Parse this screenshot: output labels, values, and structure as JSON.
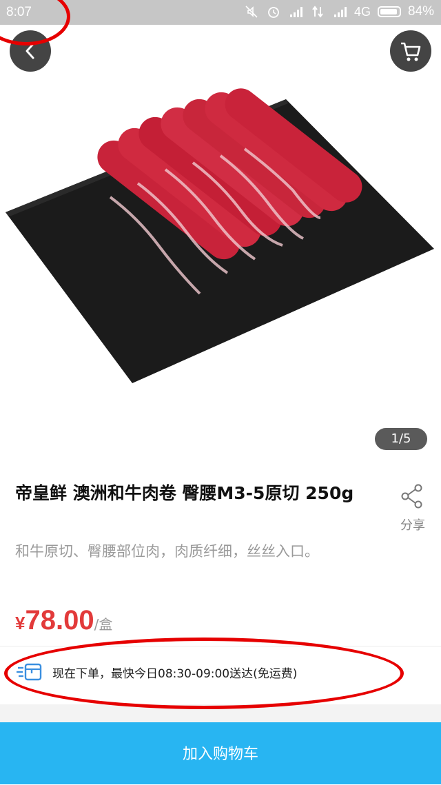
{
  "status_bar": {
    "time": "8:07",
    "network": "4G",
    "battery": "84%"
  },
  "product": {
    "image_indicator": "1/5",
    "title": "帝皇鲜 澳洲和牛肉卷 臀腰M3-5原切 250g",
    "description": "和牛原切、臀腰部位肉，肉质纤细，丝丝入口。",
    "price": {
      "currency": "¥",
      "amount": "78.00",
      "unit": "/盒"
    },
    "share_label": "分享"
  },
  "delivery": {
    "text": "现在下单，最快今日08:30-09:00送达(免运费)"
  },
  "actions": {
    "add_to_cart": "加入购物车"
  },
  "colors": {
    "accent": "#28b5f2",
    "price": "#e23a3a",
    "annotation": "#e60000"
  },
  "icons": [
    "back-arrow-icon",
    "shopping-cart-icon",
    "share-icon",
    "delivery-truck-icon",
    "mute-icon",
    "alarm-icon",
    "signal-icon",
    "data-transfer-icon"
  ]
}
